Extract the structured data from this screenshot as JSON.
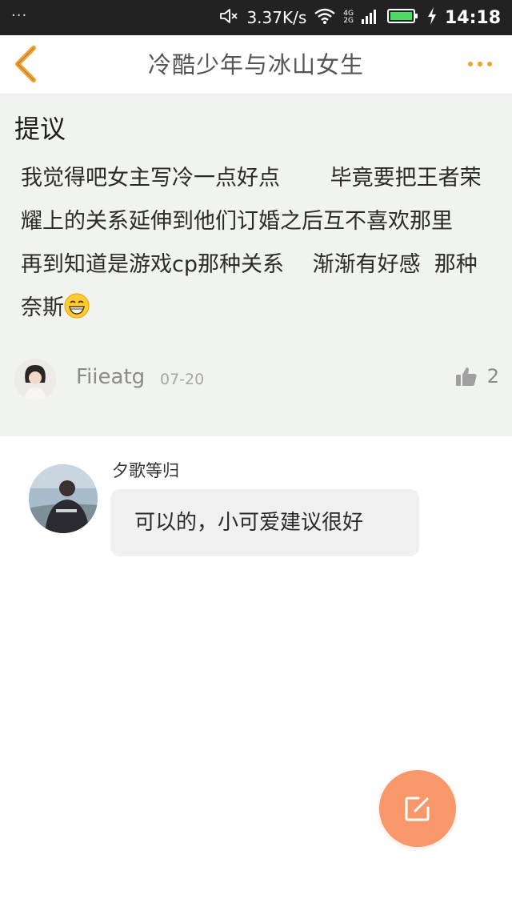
{
  "status_bar": {
    "menu_dots": "···",
    "net_speed": "3.37K/s",
    "network_top": "4G",
    "network_bottom": "2G",
    "time": "14:18",
    "icons": [
      "mute-icon",
      "wifi-icon",
      "signal-icon",
      "battery-icon",
      "charging-icon"
    ]
  },
  "nav": {
    "title": "冷酷少年与冰山女生",
    "back_icon": "chevron-left-icon",
    "more_icon": "more-dots-icon",
    "accent_color": "#f0a030"
  },
  "post": {
    "title": "提议",
    "body": "我觉得吧女主写冷一点好点　　 毕竟要把王者荣耀上的关系延伸到他们订婚之后互不喜欢那里　　 再到知道是游戏cp那种关系　 渐渐有好感  那种　　 奈斯",
    "emoji": "grinning-face-icon",
    "author": "Fiieatg",
    "date": "07-20",
    "likes": "2",
    "like_icon": "thumbs-up-icon"
  },
  "reply": {
    "author": "夕歌等归",
    "text": "可以的，小可爱建议很好"
  },
  "fab": {
    "icon": "edit-icon",
    "color": "#f8976a"
  }
}
